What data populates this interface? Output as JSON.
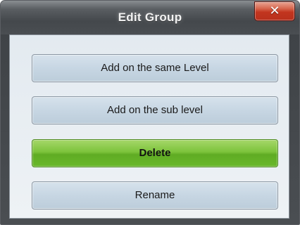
{
  "window": {
    "title": "Edit Group",
    "close_label": "✕"
  },
  "buttons": {
    "add_same_level": "Add on the same Level",
    "add_sub_level": "Add on the sub level",
    "delete": "Delete",
    "rename": "Rename"
  },
  "colors": {
    "titlebar": "#44484c",
    "close_button": "#c2351f",
    "content_background": "#e9eef3",
    "button_default": "#c7d6e3",
    "button_delete": "#7cc33b"
  },
  "icons": {
    "close": "close-icon"
  }
}
